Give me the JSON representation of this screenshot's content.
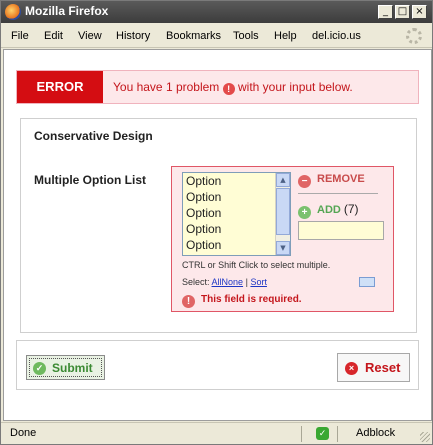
{
  "window": {
    "title": "Mozilla Firefox"
  },
  "menubar": {
    "items": [
      {
        "label": "File",
        "accel": "F"
      },
      {
        "label": "Edit",
        "accel": "E"
      },
      {
        "label": "View",
        "accel": "V"
      },
      {
        "label": "History",
        "accel": "s"
      },
      {
        "label": "Bookmarks",
        "accel": "B"
      },
      {
        "label": "Tools",
        "accel": "T"
      },
      {
        "label": "Help",
        "accel": "H"
      },
      {
        "label": "del.icio.us",
        "accel": ""
      }
    ]
  },
  "error": {
    "label": "ERROR",
    "message_before": "You have 1 problem",
    "message_after": "with your input below."
  },
  "form": {
    "legend": "Conservative Design",
    "field_label": "Multiple Option List",
    "options": [
      "Option",
      "Option",
      "Option",
      "Option",
      "Option"
    ],
    "remove_label": "REMOVE",
    "add_label": "ADD",
    "add_count": "(7)",
    "hint": "CTRL or Shift Click to select multiple.",
    "select_prefix": "Select:",
    "select_all": "All",
    "select_none": "None",
    "select_sep": "|",
    "sort_label": "Sort",
    "required_msg": "This field is required."
  },
  "buttons": {
    "submit": "Submit",
    "reset": "Reset"
  },
  "statusbar": {
    "status": "Done",
    "adblock": "Adblock"
  },
  "icons": {
    "app": "firefox-icon",
    "error": "exclamation-icon",
    "remove": "minus-icon",
    "add": "plus-icon",
    "submit": "check-icon",
    "reset": "x-icon"
  }
}
